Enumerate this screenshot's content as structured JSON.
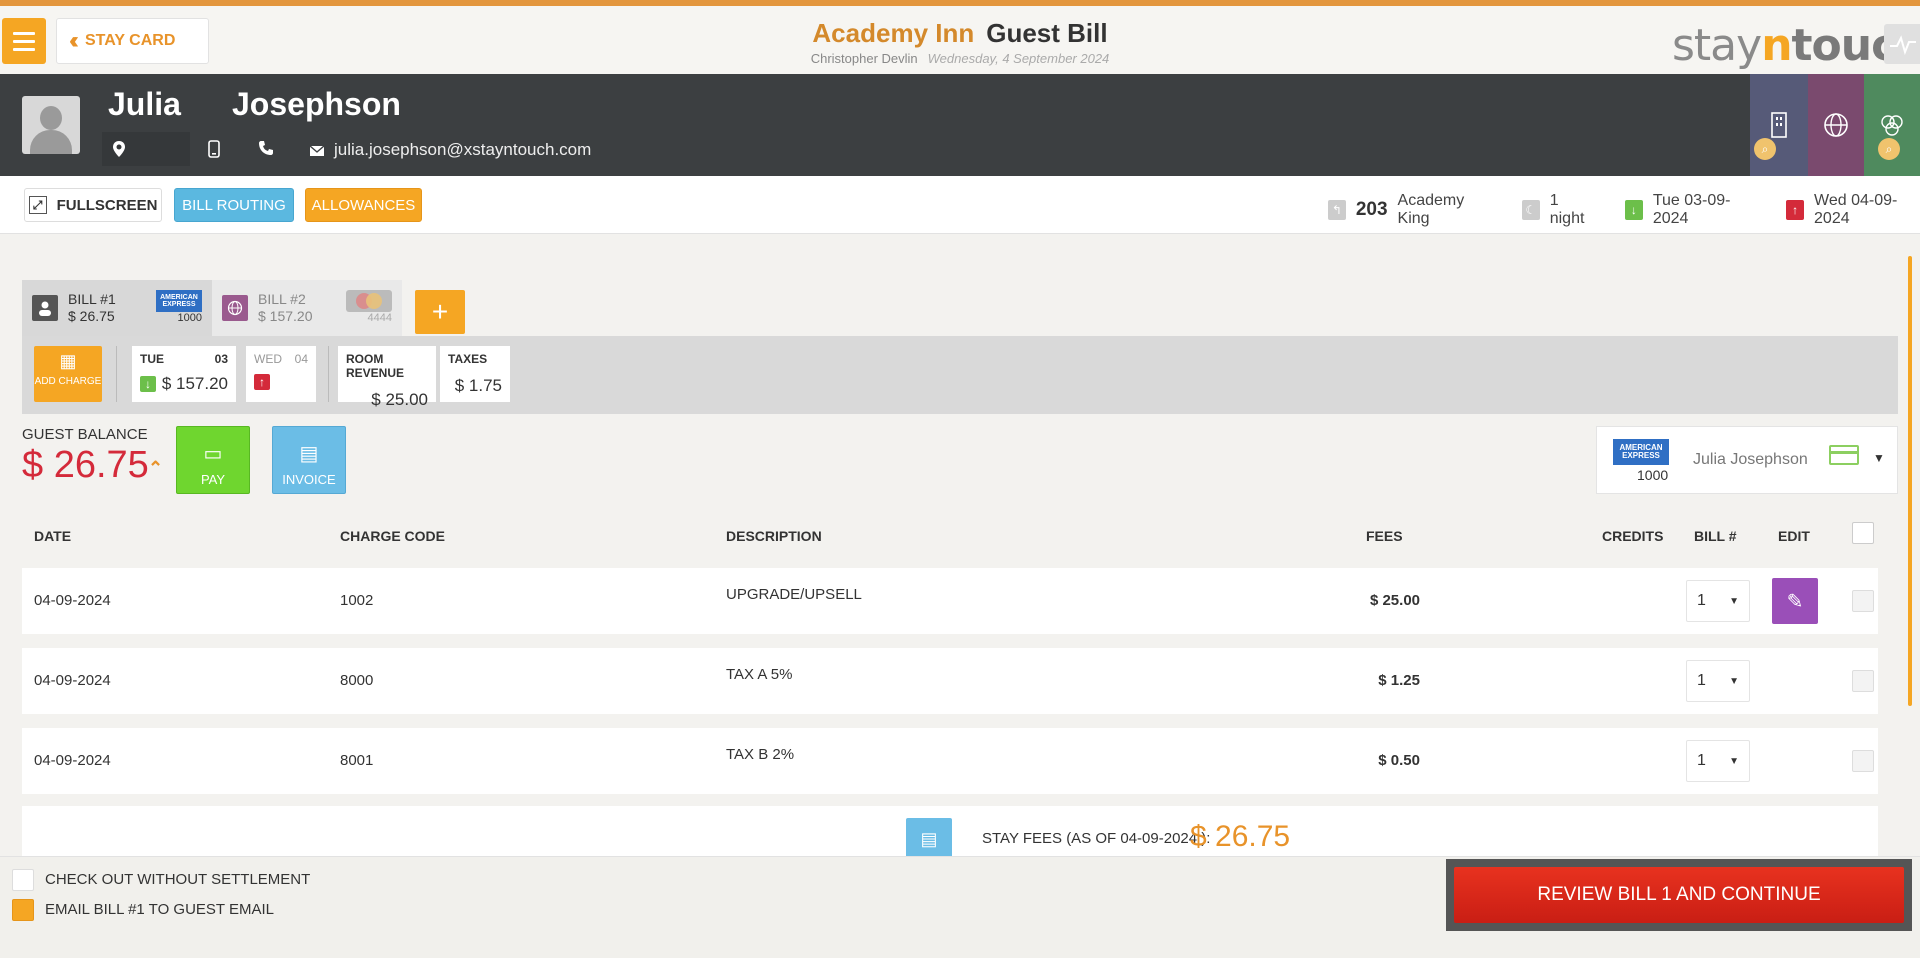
{
  "header": {
    "stay_card_label": "STAY CARD",
    "hotel_name": "Academy Inn",
    "page_title": "Guest Bill",
    "user_name": "Christopher Devlin",
    "business_date": "Wednesday, 4 September 2024",
    "brand": {
      "part1": "stay",
      "part2": "n",
      "part3": "touch"
    }
  },
  "guest": {
    "first_name": "Julia",
    "last_name": "Josephson",
    "email": "julia.josephson@xstayntouch.com"
  },
  "actions": {
    "fullscreen": "FULLSCREEN",
    "bill_routing": "BILL ROUTING",
    "allowances": "ALLOWANCES"
  },
  "reservation": {
    "room_number": "203",
    "room_type": "Academy King",
    "nights": "1 night",
    "arrival": "Tue 03-09-2024",
    "departure": "Wed 04-09-2024"
  },
  "bills": [
    {
      "label": "BILL #1",
      "amount": "$ 26.75",
      "card_brand": "AMERICAN EXPRESS",
      "card_number": "1000"
    },
    {
      "label": "BILL #2",
      "amount": "$ 157.20",
      "card_brand": "mastercard",
      "card_number": "4444"
    }
  ],
  "summary": {
    "add_charge": "ADD CHARGE",
    "day1": {
      "dow": "TUE",
      "day": "03",
      "amount": "$ 157.20"
    },
    "day2": {
      "dow": "WED",
      "day": "04"
    },
    "room_revenue": {
      "label": "ROOM REVENUE",
      "amount": "$ 25.00"
    },
    "taxes": {
      "label": "TAXES",
      "amount": "$ 1.75"
    }
  },
  "balance": {
    "label": "GUEST BALANCE",
    "amount": "$ 26.75",
    "pay": "PAY",
    "invoice": "INVOICE"
  },
  "payer": {
    "card_brand": "AMERICAN EXPRESS",
    "card_number": "1000",
    "name": "Julia Josephson"
  },
  "table": {
    "headers": {
      "date": "DATE",
      "charge_code": "CHARGE CODE",
      "description": "DESCRIPTION",
      "fees": "FEES",
      "credits": "CREDITS",
      "bill_no": "BILL #",
      "edit": "EDIT"
    },
    "rows": [
      {
        "date": "04-09-2024",
        "code": "1002",
        "description": "UPGRADE/UPSELL",
        "fees": "$ 25.00",
        "bill": "1"
      },
      {
        "date": "04-09-2024",
        "code": "8000",
        "description": "TAX A 5%",
        "fees": "$ 1.25",
        "bill": "1"
      },
      {
        "date": "04-09-2024",
        "code": "8001",
        "description": "TAX B 2%",
        "fees": "$ 0.50",
        "bill": "1"
      }
    ],
    "stay_fees_label": "STAY FEES (AS OF  04-09-2024 ):",
    "stay_fees_amount": "$ 26.75"
  },
  "footer": {
    "checkout_without_settlement": "CHECK OUT WITHOUT SETTLEMENT",
    "email_bill": "EMAIL BILL #1 TO GUEST EMAIL",
    "review_button": "REVIEW BILL 1 AND CONTINUE"
  },
  "colors": {
    "accent": "#f5a623",
    "danger": "#d42a3a",
    "info": "#5bb8e0",
    "success": "#6fd62f",
    "edit": "#9a4fb8"
  }
}
